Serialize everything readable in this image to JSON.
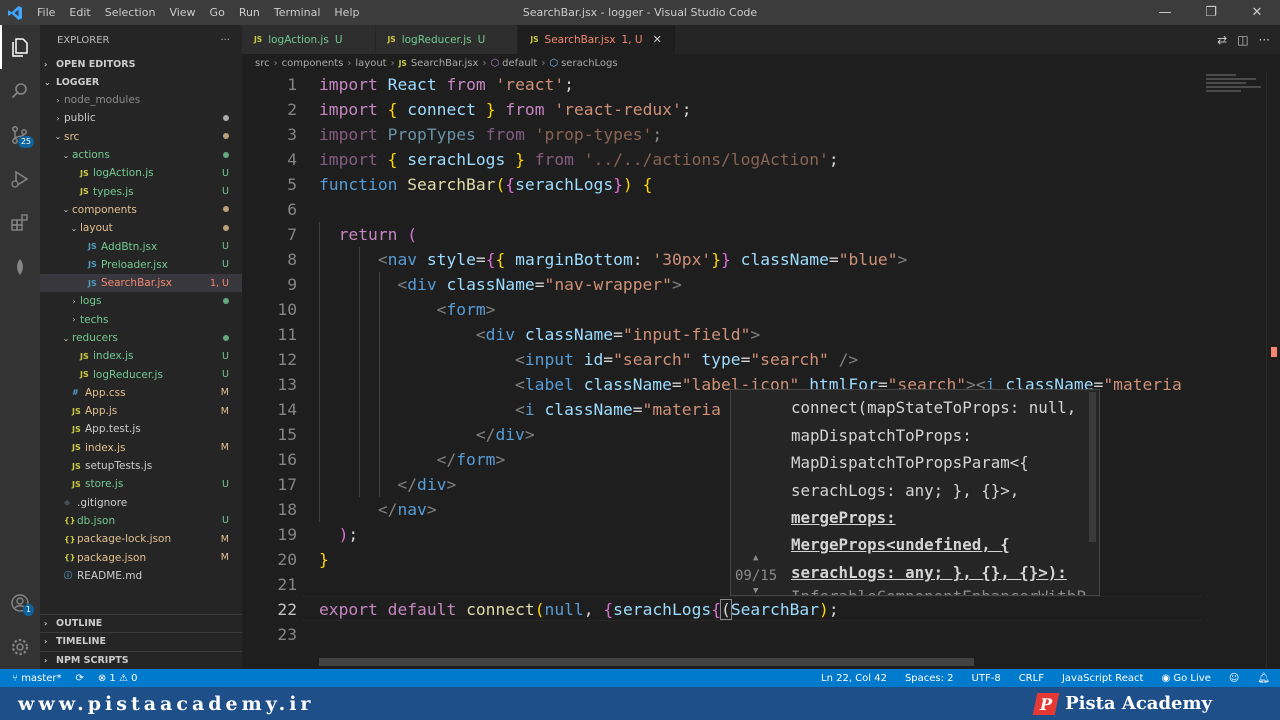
{
  "window": {
    "title": "SearchBar.jsx - logger - Visual Studio Code",
    "menu": [
      "File",
      "Edit",
      "Selection",
      "View",
      "Go",
      "Run",
      "Terminal",
      "Help"
    ],
    "controls": {
      "minimize": "—",
      "maximize": "❐",
      "close": "✕"
    }
  },
  "activity": {
    "scm_badge": "25",
    "accounts_badge": "1"
  },
  "sidebar": {
    "title": "EXPLORER",
    "more": "···",
    "open_editors": "OPEN EDITORS",
    "project": "LOGGER",
    "tree": [
      {
        "label": "node_modules",
        "type": "folder",
        "depth": 1,
        "open": false,
        "status": "",
        "color": "#8c8c8c"
      },
      {
        "label": "public",
        "type": "folder",
        "depth": 1,
        "open": false,
        "status": "dot",
        "color": "#cccccc"
      },
      {
        "label": "src",
        "type": "folder",
        "depth": 1,
        "open": true,
        "status": "dot",
        "color": "#e2c08d"
      },
      {
        "label": "actions",
        "type": "folder",
        "depth": 2,
        "open": true,
        "status": "dot",
        "color": "#73c991"
      },
      {
        "label": "logAction.js",
        "type": "js",
        "depth": 3,
        "status": "U",
        "color": "#73c991"
      },
      {
        "label": "types.js",
        "type": "js",
        "depth": 3,
        "status": "U",
        "color": "#73c991"
      },
      {
        "label": "components",
        "type": "folder",
        "depth": 2,
        "open": true,
        "status": "dot",
        "color": "#e2c08d"
      },
      {
        "label": "layout",
        "type": "folder",
        "depth": 3,
        "open": true,
        "status": "dot",
        "color": "#e2c08d"
      },
      {
        "label": "AddBtn.jsx",
        "type": "jsx",
        "depth": 4,
        "status": "U",
        "color": "#73c991"
      },
      {
        "label": "Preloader.jsx",
        "type": "jsx",
        "depth": 4,
        "status": "U",
        "color": "#73c991"
      },
      {
        "label": "SearchBar.jsx",
        "type": "jsx",
        "depth": 4,
        "status": "1, U",
        "color": "#f48771",
        "selected": true
      },
      {
        "label": "logs",
        "type": "folder",
        "depth": 3,
        "open": false,
        "status": "dot",
        "color": "#73c991"
      },
      {
        "label": "techs",
        "type": "folder",
        "depth": 3,
        "open": false,
        "status": "",
        "color": "#73c991"
      },
      {
        "label": "reducers",
        "type": "folder",
        "depth": 2,
        "open": true,
        "status": "dot",
        "color": "#73c991"
      },
      {
        "label": "index.js",
        "type": "js",
        "depth": 3,
        "status": "U",
        "color": "#73c991"
      },
      {
        "label": "logReducer.js",
        "type": "js",
        "depth": 3,
        "status": "U",
        "color": "#73c991"
      },
      {
        "label": "App.css",
        "type": "css",
        "depth": 2,
        "status": "M",
        "color": "#e2c08d"
      },
      {
        "label": "App.js",
        "type": "js",
        "depth": 2,
        "status": "M",
        "color": "#e2c08d"
      },
      {
        "label": "App.test.js",
        "type": "js",
        "depth": 2,
        "status": "",
        "color": "#cccccc"
      },
      {
        "label": "index.js",
        "type": "js",
        "depth": 2,
        "status": "M",
        "color": "#e2c08d"
      },
      {
        "label": "setupTests.js",
        "type": "js",
        "depth": 2,
        "status": "",
        "color": "#cccccc"
      },
      {
        "label": "store.js",
        "type": "js",
        "depth": 2,
        "status": "U",
        "color": "#73c991"
      },
      {
        "label": ".gitignore",
        "type": "git",
        "depth": 1,
        "status": "",
        "color": "#cccccc"
      },
      {
        "label": "db.json",
        "type": "json",
        "depth": 1,
        "status": "U",
        "color": "#73c991"
      },
      {
        "label": "package-lock.json",
        "type": "json",
        "depth": 1,
        "status": "M",
        "color": "#e2c08d"
      },
      {
        "label": "package.json",
        "type": "json",
        "depth": 1,
        "status": "M",
        "color": "#e2c08d"
      },
      {
        "label": "README.md",
        "type": "md",
        "depth": 1,
        "status": "",
        "color": "#cccccc"
      }
    ],
    "outline": "OUTLINE",
    "timeline": "TIMELINE",
    "npm": "NPM SCRIPTS"
  },
  "tabs": [
    {
      "label": "logAction.js",
      "status": "U",
      "active": false
    },
    {
      "label": "logReducer.js",
      "status": "U",
      "active": false
    },
    {
      "label": "SearchBar.jsx",
      "status": "1, U",
      "active": true
    }
  ],
  "breadcrumb": {
    "parts": [
      "src",
      "components",
      "layout",
      "SearchBar.jsx",
      "default",
      "serachLogs"
    ]
  },
  "editor": {
    "line_numbers": [
      "1",
      "2",
      "3",
      "4",
      "5",
      "6",
      "7",
      "8",
      "9",
      "10",
      "11",
      "12",
      "13",
      "14",
      "15",
      "16",
      "17",
      "18",
      "19",
      "20",
      "21",
      "22",
      "23"
    ],
    "current_line": "22"
  },
  "signature_help": {
    "lines": [
      "connect(mapStateToProps: null,",
      "mapDispatchToProps:",
      "MapDispatchToPropsParam<{",
      "serachLogs: any; }, {}>,",
      "mergeProps:",
      "MergeProps<undefined, {",
      "serachLogs: any; }, {}, {}>):",
      "InferableComponentEnhancerWithP"
    ],
    "counter": "09/15"
  },
  "statusbar": {
    "branch": "master*",
    "problems": "⊗ 1 ⚠ 0",
    "position": "Ln 22, Col 42",
    "spaces": "Spaces: 2",
    "encoding": "UTF-8",
    "eol": "CRLF",
    "language": "JavaScript React",
    "golive": "Go Live"
  },
  "footer": {
    "url": "www.pistaacademy.ir",
    "brand": "Pista Academy",
    "logo_letter": "P"
  },
  "colors": {
    "status_bar": "#007acc",
    "footer": "#1e4f88",
    "untracked": "#73c991",
    "modified": "#e2c08d",
    "error": "#f48771"
  }
}
